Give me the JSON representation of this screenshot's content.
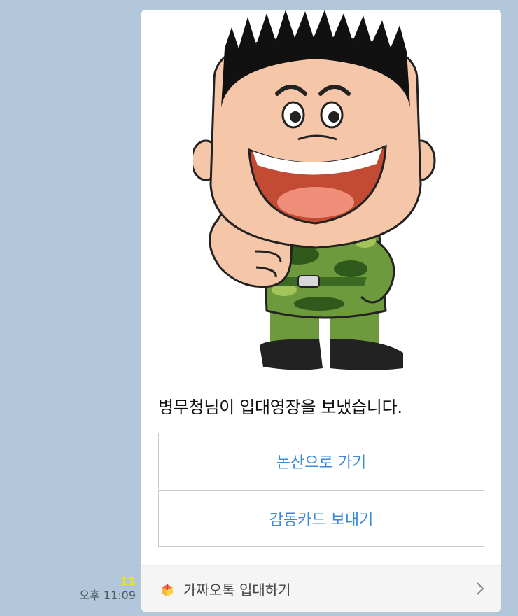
{
  "message": {
    "text": "병무청님이 입대영장을 보냈습니다.",
    "buttons": [
      {
        "label": "논산으로 가기"
      },
      {
        "label": "감동카드 보내기"
      }
    ],
    "footer": {
      "label": "가짜오톡 입대하기",
      "icon": "gift-box-icon",
      "chevron": "chevron-right-icon"
    },
    "unread_count": "11",
    "time": "오후 11:09"
  },
  "colors": {
    "background": "#b2c7d9",
    "button_text": "#3a8ad8",
    "unread": "#f7e600"
  }
}
